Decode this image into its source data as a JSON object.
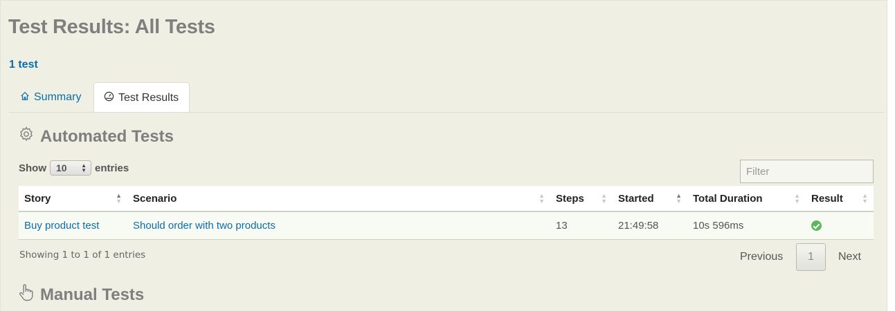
{
  "page": {
    "title": "Test Results: All Tests",
    "count_link": "1 test"
  },
  "tabs": [
    {
      "label": "Summary",
      "icon": "home-icon",
      "active": false
    },
    {
      "label": "Test Results",
      "icon": "dashboard-icon",
      "active": true
    }
  ],
  "automated": {
    "title": "Automated Tests",
    "icon": "gear-icon",
    "show_label": "Show",
    "entries_value": "10",
    "entries_label": "entries",
    "filter_placeholder": "Filter",
    "columns": [
      "Story",
      "Scenario",
      "Steps",
      "Started",
      "Total Duration",
      "Result"
    ],
    "rows": [
      {
        "story": "Buy product test",
        "scenario": "Should order with two products",
        "steps": "13",
        "started": "21:49:58",
        "duration": "10s 596ms",
        "result": "success-icon"
      }
    ],
    "showing_text": "Showing 1 to 1 of 1 entries",
    "pagination": {
      "previous": "Previous",
      "page": "1",
      "next": "Next"
    }
  },
  "manual": {
    "title": "Manual Tests",
    "icon": "hand-pointer-icon"
  },
  "colors": {
    "link": "#0b6ea8",
    "panel_bg": "#efefe3",
    "success": "#5cb85c",
    "heading": "#7f7f7f"
  }
}
